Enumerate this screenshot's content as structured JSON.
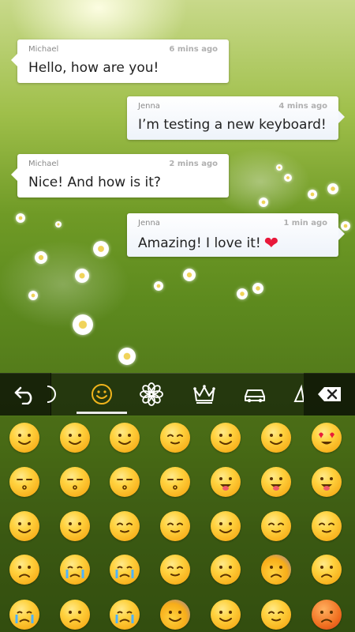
{
  "chat": {
    "messages": [
      {
        "sender": "Michael",
        "time": "6 mins ago",
        "text": "Hello, how are you!",
        "side": "left"
      },
      {
        "sender": "Jenna",
        "time": "4 mins ago",
        "text": "I’m testing a new keyboard!",
        "side": "right"
      },
      {
        "sender": "Michael",
        "time": "2 mins ago",
        "text": "Nice! And how is it?",
        "side": "left"
      },
      {
        "sender": "Jenna",
        "time": "1 min ago",
        "text": "Amazing! I love it!",
        "side": "right",
        "emoji": "❤"
      }
    ]
  },
  "keyboard": {
    "toolbar": {
      "back": "back-arrow-icon",
      "categories": [
        "recent-icon",
        "smiley-icon",
        "flower-icon",
        "crown-icon",
        "car-icon",
        "symbols-icon"
      ],
      "active_category": "smiley-icon",
      "delete": "backspace-icon"
    },
    "emoji_rows": [
      [
        "grin",
        "starstruck",
        "smile",
        "content",
        "blush-smile",
        "wink",
        "heart-eyes"
      ],
      [
        "kiss-heart",
        "kiss-closed",
        "kiss",
        "kiss-blush",
        "tongue-out",
        "tongue-wink",
        "tongue-open"
      ],
      [
        "flushed",
        "grimace",
        "relieved",
        "pensive",
        "smirk",
        "squint",
        "persevere"
      ],
      [
        "worried",
        "crying",
        "sobbing",
        "sleepy",
        "sweat",
        "fearful",
        "cold-sweat"
      ],
      [
        "sleepy-tear",
        "tired",
        "angry-tears",
        "cold",
        "yawn",
        "unamused",
        "angry"
      ]
    ],
    "accent_color": "#f0b41c"
  }
}
